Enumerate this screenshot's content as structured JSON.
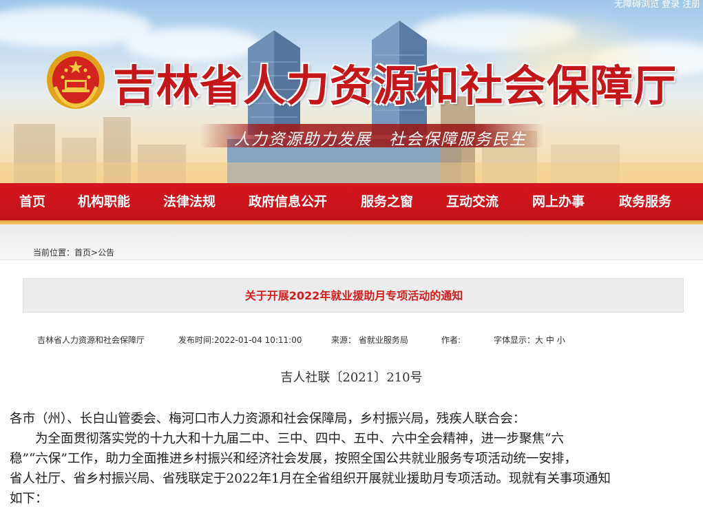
{
  "header": {
    "top_links": [
      "无障碍浏览",
      "登录",
      "注册"
    ],
    "site_title": "吉林省人力资源和社会保障厅",
    "slogan": "人力资源助力发展　社会保障服务民生",
    "colors": {
      "brand_red": "#c5161a",
      "nav_red": "#d4171c",
      "gold": "#f4d07a"
    }
  },
  "nav": {
    "items": [
      "首页",
      "机构职能",
      "法律法规",
      "政府信息公开",
      "服务之窗",
      "互动交流",
      "网上办事",
      "政务服务"
    ]
  },
  "breadcrumb": {
    "prefix": "当前位置：",
    "home": "首页",
    "separator": ">",
    "current": "公告"
  },
  "article": {
    "title": "关于开展2022年就业援助月专项活动的通知",
    "meta": {
      "publisher": "吉林省人力资源和社会保障厅",
      "published": "发布时间:2022-01-04 10:11:00",
      "source": "来源： 省就业服务局",
      "author": "作者:",
      "font_size_label": "字体显示：",
      "font_size_options": [
        "大",
        "中",
        "小"
      ]
    },
    "doc_number": "吉人社联〔2021〕210号",
    "body": [
      "各市（州）、长白山管委会、梅河口市人力资源和社会保障局，乡村振兴局，残疾人联合会：",
      "　　为全面贯彻落实党的十九大和十九届二中、三中、四中、五中、六中全会精神，进一步聚焦“六",
      "稳”“六保”工作，助力全面推进乡村振兴和经济社会发展，按照全国公共就业服务专项活动统一安排，",
      "省人社厅、省乡村振兴局、省残联定于2022年1月在全省组织开展就业援助月专项活动。现就有关事项通知",
      "如下："
    ]
  }
}
